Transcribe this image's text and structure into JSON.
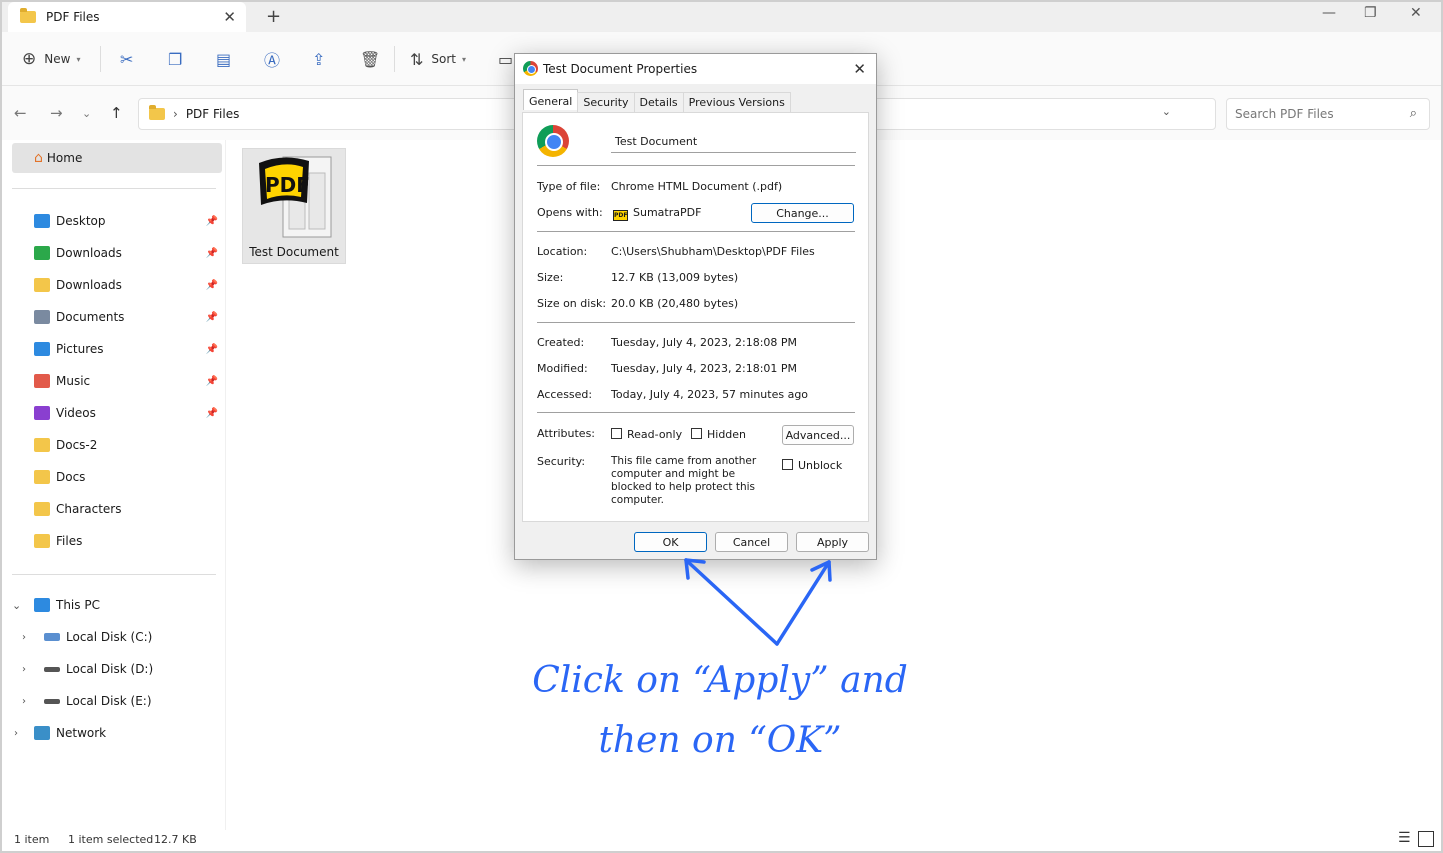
{
  "tab": {
    "title": "PDF Files",
    "close": "✕",
    "new": "+"
  },
  "window": {
    "minimize": "—",
    "maximize": "❐",
    "close": "✕"
  },
  "toolbar": {
    "new_label": "New",
    "sort_label": "Sort"
  },
  "address": {
    "path": "PDF Files",
    "search_placeholder": "Search PDF Files"
  },
  "sidebar": {
    "home": "Home",
    "quick": [
      {
        "label": "Desktop",
        "icon": "desktop-icon",
        "color": "#2d8ae0"
      },
      {
        "label": "Downloads",
        "icon": "download-icon",
        "color": "#2ba84a"
      },
      {
        "label": "Downloads",
        "icon": "folder-icon",
        "color": "#f3c64a"
      },
      {
        "label": "Documents",
        "icon": "documents-icon",
        "color": "#7a8aa0"
      },
      {
        "label": "Pictures",
        "icon": "pictures-icon",
        "color": "#2d8ae0"
      },
      {
        "label": "Music",
        "icon": "music-icon",
        "color": "#e25a4a"
      },
      {
        "label": "Videos",
        "icon": "videos-icon",
        "color": "#8a3fd0"
      },
      {
        "label": "Docs-2",
        "icon": "folder-icon",
        "color": "#f3c64a"
      },
      {
        "label": "Docs",
        "icon": "folder-icon",
        "color": "#f3c64a"
      },
      {
        "label": "Characters",
        "icon": "folder-icon",
        "color": "#f3c64a"
      },
      {
        "label": "Files",
        "icon": "folder-icon",
        "color": "#f3c64a"
      }
    ],
    "this_pc": "This PC",
    "drives": [
      "Local Disk (C:)",
      "Local Disk (D:)",
      "Local Disk (E:)"
    ],
    "network": "Network"
  },
  "file": {
    "name": "Test Document",
    "thumb_text": "PDF"
  },
  "status": {
    "count": "1 item",
    "selected": "1 item selected",
    "size": "12.7 KB"
  },
  "dialog": {
    "title": "Test Document Properties",
    "tabs": [
      "General",
      "Security",
      "Details",
      "Previous Versions"
    ],
    "file_name": "Test Document",
    "type_label": "Type of file:",
    "type_value": "Chrome HTML Document (.pdf)",
    "opens_label": "Opens with:",
    "opens_value": "SumatraPDF",
    "change_button": "Change...",
    "location_label": "Location:",
    "location_value": "C:\\Users\\Shubham\\Desktop\\PDF Files",
    "size_label": "Size:",
    "size_value": "12.7 KB (13,009 bytes)",
    "size_disk_label": "Size on disk:",
    "size_disk_value": "20.0 KB (20,480 bytes)",
    "created_label": "Created:",
    "created_value": "Tuesday, July 4, 2023, 2:18:08 PM",
    "modified_label": "Modified:",
    "modified_value": "Tuesday, July 4, 2023, 2:18:01 PM",
    "accessed_label": "Accessed:",
    "accessed_value": "Today, July 4, 2023, 57 minutes ago",
    "attributes_label": "Attributes:",
    "readonly_label": "Read-only",
    "hidden_label": "Hidden",
    "advanced_button": "Advanced...",
    "security_label": "Security:",
    "security_text": "This file came from another computer and might be blocked to help protect this computer.",
    "unblock_label": "Unblock",
    "ok_button": "OK",
    "cancel_button": "Cancel",
    "apply_button": "Apply",
    "close": "✕"
  },
  "annotation": {
    "line1": "Click on “Apply” and",
    "line2": "then on “OK”",
    "color": "#2a66f5"
  }
}
